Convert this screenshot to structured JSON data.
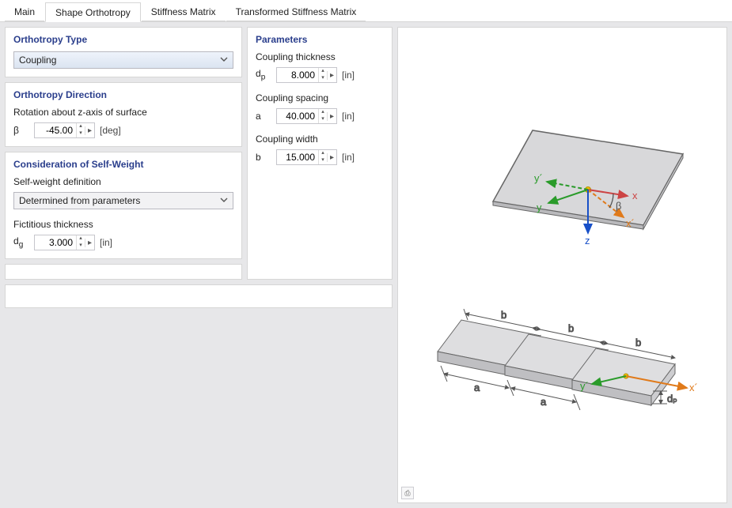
{
  "tabs": {
    "main": "Main",
    "shape_orthotropy": "Shape Orthotropy",
    "stiffness_matrix": "Stiffness Matrix",
    "transformed_stiffness_matrix": "Transformed Stiffness Matrix",
    "active": "shape_orthotropy"
  },
  "orthotropy_type": {
    "title": "Orthotropy Type",
    "value": "Coupling"
  },
  "orthotropy_direction": {
    "title": "Orthotropy Direction",
    "label": "Rotation about z-axis of surface",
    "symbol": "β",
    "value": "-45.00",
    "unit": "[deg]"
  },
  "self_weight": {
    "title": "Consideration of Self-Weight",
    "def_label": "Self-weight definition",
    "def_value": "Determined from parameters",
    "thickness_label": "Fictitious thickness",
    "thickness_symbol": "d_g",
    "thickness_value": "3.000",
    "thickness_unit": "[in]"
  },
  "parameters": {
    "title": "Parameters",
    "thickness_label": "Coupling thickness",
    "thickness_symbol": "d_p",
    "thickness_value": "8.000",
    "thickness_unit": "[in]",
    "spacing_label": "Coupling spacing",
    "spacing_symbol": "a",
    "spacing_value": "40.000",
    "spacing_unit": "[in]",
    "width_label": "Coupling width",
    "width_symbol": "b",
    "width_value": "15.000",
    "width_unit": "[in]"
  },
  "diagram": {
    "y_label": "y",
    "yprime": "y´",
    "x_label": "x",
    "xprime": "x´",
    "z_label": "z",
    "beta": "β",
    "a": "a",
    "b": "b",
    "dp": "dₚ"
  }
}
